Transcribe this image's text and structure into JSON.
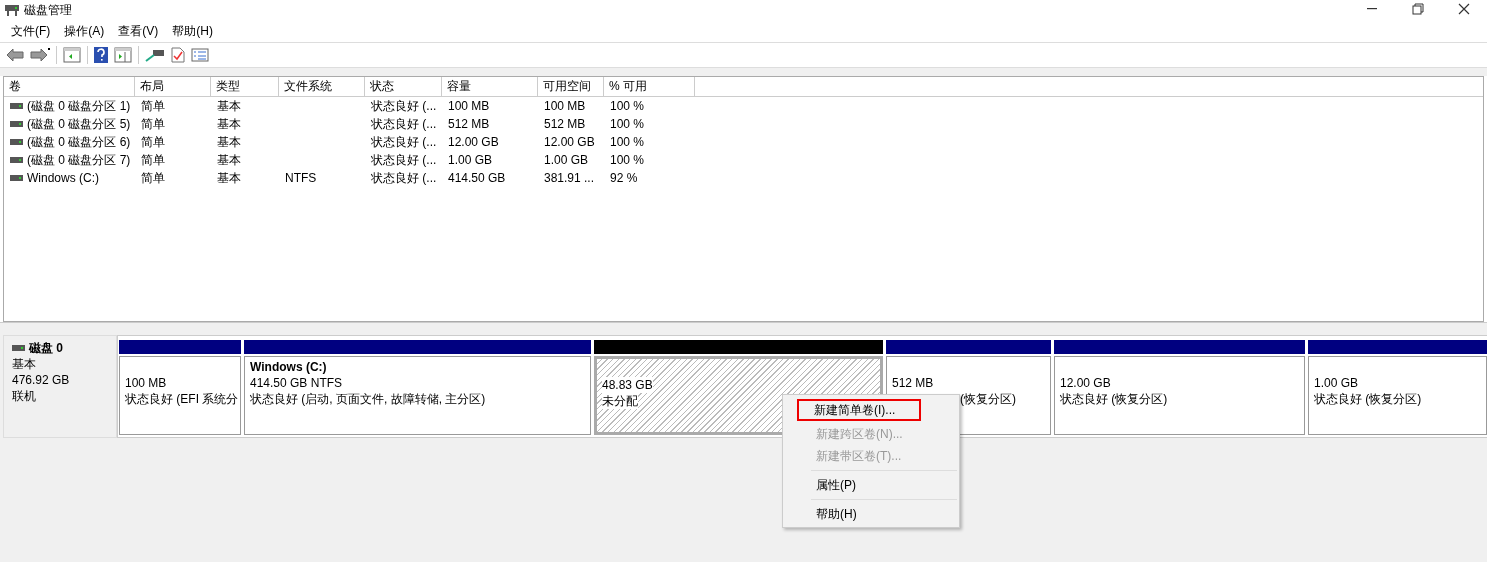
{
  "window": {
    "title": "磁盘管理"
  },
  "menu": [
    "文件(F)",
    "操作(A)",
    "查看(V)",
    "帮助(H)"
  ],
  "table": {
    "columns": [
      "卷",
      "布局",
      "类型",
      "文件系统",
      "状态",
      "容量",
      "可用空间",
      "% 可用"
    ],
    "rows": [
      [
        "(磁盘 0 磁盘分区 1)",
        "简单",
        "基本",
        "",
        "状态良好 (...",
        "100 MB",
        "100 MB",
        "100 %"
      ],
      [
        "(磁盘 0 磁盘分区 5)",
        "简单",
        "基本",
        "",
        "状态良好 (...",
        "512 MB",
        "512 MB",
        "100 %"
      ],
      [
        "(磁盘 0 磁盘分区 6)",
        "简单",
        "基本",
        "",
        "状态良好 (...",
        "12.00 GB",
        "12.00 GB",
        "100 %"
      ],
      [
        "(磁盘 0 磁盘分区 7)",
        "简单",
        "基本",
        "",
        "状态良好 (...",
        "1.00 GB",
        "1.00 GB",
        "100 %"
      ],
      [
        "Windows (C:)",
        "简单",
        "基本",
        "NTFS",
        "状态良好 (...",
        "414.50 GB",
        "381.91 ...",
        "92 %"
      ]
    ]
  },
  "disk": {
    "name": "磁盘 0",
    "type": "基本",
    "size": "476.92 GB",
    "status": "联机"
  },
  "partitions": [
    {
      "kind": "primary",
      "size": "100 MB",
      "status": "状态良好 (EFI 系统分",
      "selected": false,
      "covered": false
    },
    {
      "kind": "primary",
      "label": "Windows  (C:)",
      "size": "414.50 GB NTFS",
      "status": "状态良好 (启动, 页面文件, 故障转储, 主分区)",
      "selected": false,
      "covered": false
    },
    {
      "kind": "unallocated",
      "size": "48.83 GB",
      "status": "未分配",
      "selected": true,
      "covered": false
    },
    {
      "kind": "primary",
      "size": "512 MB",
      "status": "(恢复分区)",
      "selected": false,
      "covered": true
    },
    {
      "kind": "primary",
      "size": "12.00 GB",
      "status": "状态良好 (恢复分区)",
      "selected": false,
      "covered": false
    },
    {
      "kind": "primary",
      "size": "1.00 GB",
      "status": "状态良好 (恢复分区)",
      "selected": false,
      "covered": false
    }
  ],
  "context_menu": [
    {
      "label": "新建简单卷(I)...",
      "disabled": false,
      "highlighted": true,
      "separator_before": false
    },
    {
      "label": "新建跨区卷(N)...",
      "disabled": true,
      "highlighted": false,
      "separator_before": false
    },
    {
      "label": "新建带区卷(T)...",
      "disabled": true,
      "highlighted": false,
      "separator_before": false
    },
    {
      "label": "属性(P)",
      "disabled": false,
      "highlighted": false,
      "separator_before": true
    },
    {
      "label": "帮助(H)",
      "disabled": false,
      "highlighted": false,
      "separator_before": true
    }
  ]
}
